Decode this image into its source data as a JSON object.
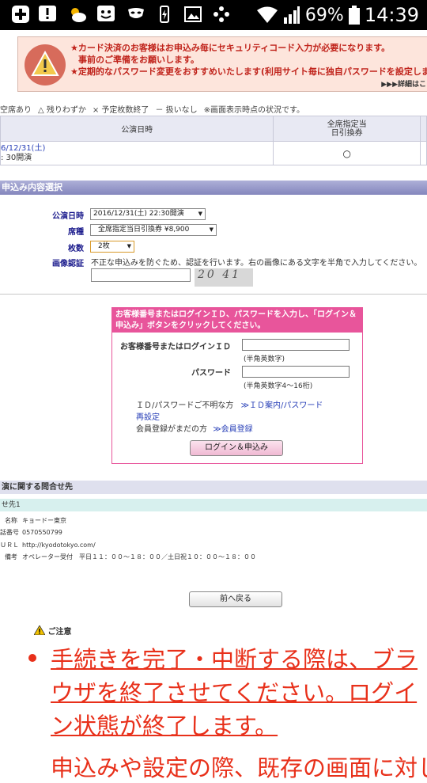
{
  "status_bar": {
    "battery": "69%",
    "time": "14:39",
    "icons": [
      "plus-square-icon",
      "alert-square-icon",
      "weather-icon",
      "face-square-icon",
      "mask-icon",
      "battery-saver-icon",
      "image-icon",
      "flower-icon",
      "wifi-icon",
      "signal-icon",
      "battery-icon"
    ]
  },
  "warning": {
    "line1": "★カード決済のお客様はお申込み毎にセキュリティコード入力が必要になります。",
    "line2": "事前のご準備をお願いします。",
    "line3": "★定期的なパスワード変更をおすすめいたします(利用サイト毎に独自パスワードを設定しましょ",
    "more": "▶▶▶詳細はこ"
  },
  "legend": [
    "空席あり",
    "△ 残りわずか",
    "× 予定枚数終了",
    "－ 扱いなし",
    "※画面表示時点の状況です。"
  ],
  "perf_table": {
    "headers": [
      "公演日時",
      "全席指定当\n日引換券"
    ],
    "row": {
      "date_line1": "6/12/31(土)",
      "date_line2": ": 30開演",
      "mark": "○"
    }
  },
  "section_select": "申込み内容選択",
  "form": {
    "date_label": "公演日時",
    "date_value": "2016/12/31(土) 22:30開演",
    "seat_label": "席種",
    "seat_value": "全席指定当日引換券 ¥8,900",
    "qty_label": "枚数",
    "qty_value": "2枚",
    "captcha_label": "画像認証",
    "captcha_note": "不正な申込みを防ぐため、認証を行います。右の画像にある文字を半角で入力してください。",
    "captcha_text": "20 41"
  },
  "login": {
    "head": "お客様番号またはログインＩＤ、パスワードを入力し、「ログイン＆申込み」ボタンをクリックしてください。",
    "id_label": "お客様番号またはログインＩＤ",
    "id_hint": "(半角英数字)",
    "pw_label": "パスワード",
    "pw_hint": "(半角英数字4～16桁)",
    "forgot_text": "ＩＤ/パスワードご不明な方",
    "forgot_link": "≫ＩＤ案内/パスワード",
    "forgot_link2": "再設定",
    "register_text": "会員登録がまだの方",
    "register_link": "≫会員登録",
    "button": "ログイン＆申込み"
  },
  "contact": {
    "title": "演に関する問合せ先",
    "sub": "せ先1",
    "rows": [
      {
        "k": "名称",
        "v": "キョードー東京"
      },
      {
        "k": "話番号",
        "v": "0570550799"
      },
      {
        "k": "ＵＲＬ",
        "v": "http://kyodotokyo.com/"
      },
      {
        "k": "備考",
        "v": "オペレーター受付　平日１１：００～１８：００／土日祝１０：００～１８：００"
      }
    ]
  },
  "back_button": "前へ戻る",
  "notice_title": "ご注意",
  "notice_text": "手続きを完了・中断する際は、ブラウザを終了させてください。ログイン状態が終了します。",
  "notice_next": "申込みや設定の際、既存の画面に対し"
}
